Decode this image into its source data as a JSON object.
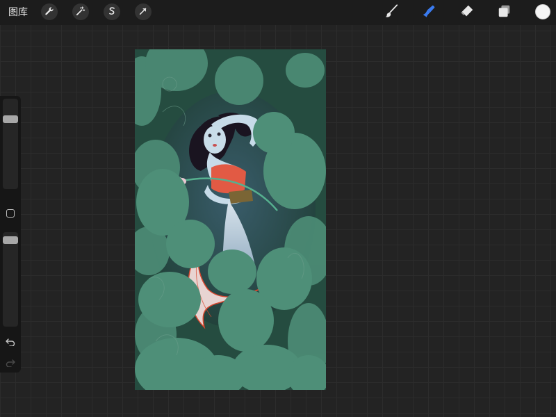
{
  "topbar": {
    "gallery_label": "图库",
    "left_tools": [
      {
        "name": "wrench-icon"
      },
      {
        "name": "magic-wand-icon"
      },
      {
        "name": "selection-s-icon"
      },
      {
        "name": "move-arrow-icon"
      }
    ],
    "right_tools": [
      {
        "name": "brush-icon",
        "active": false
      },
      {
        "name": "smudge-icon",
        "active": true
      },
      {
        "name": "eraser-icon",
        "active": false
      },
      {
        "name": "layers-icon",
        "active": false
      }
    ],
    "current_color": "#f5f5f5",
    "active_color": "#3a7bf0"
  },
  "sidebar": {
    "brush_size_level": 0.2,
    "opacity_level": 0.05,
    "undo_icon": "undo-arrow-icon",
    "redo_icon": "redo-arrow-icon"
  },
  "canvas": {
    "background_color": "#254c40",
    "leaf_color": "#4e8f78",
    "skin_color": "#c7dbe8",
    "dress_color": "#e25a44",
    "hair_color": "#1a1420"
  }
}
